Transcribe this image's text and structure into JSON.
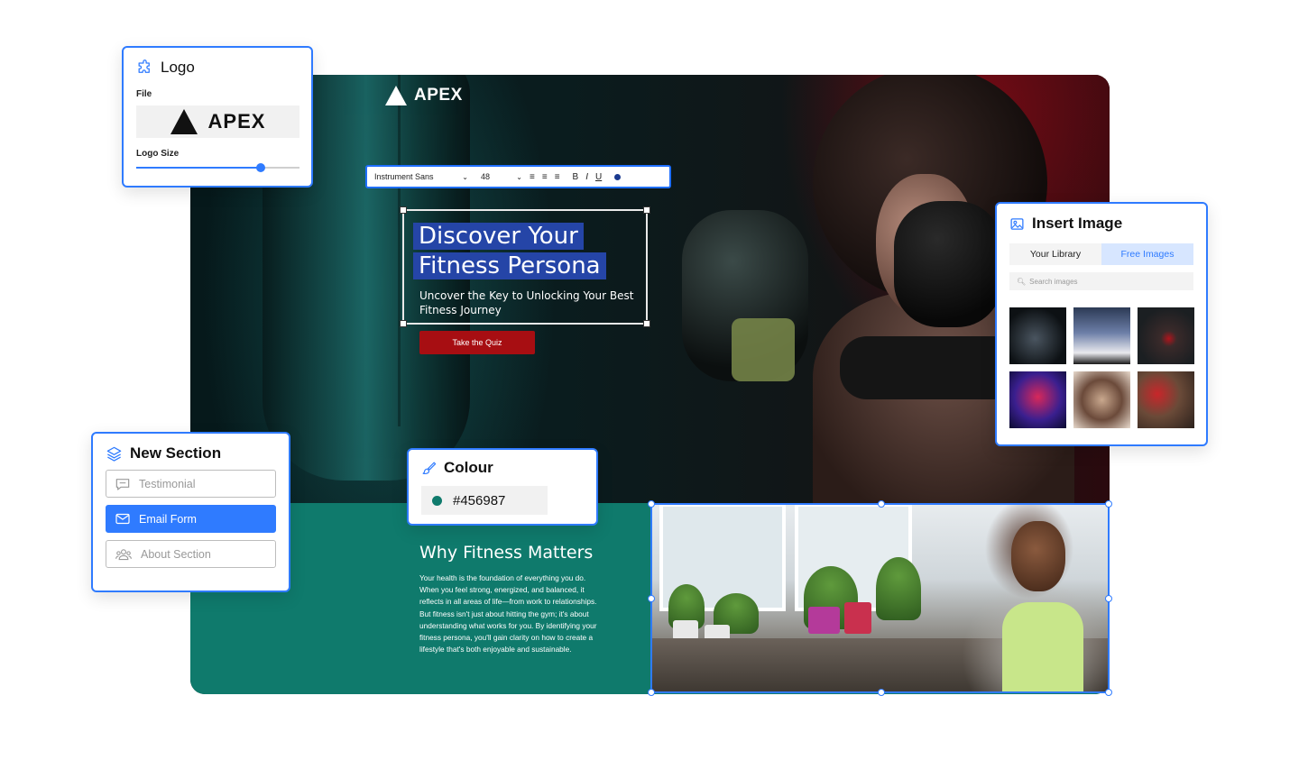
{
  "brand": {
    "name": "APEX"
  },
  "toolbar": {
    "font": "Instrument Sans",
    "size": "48",
    "align_left": "≡",
    "align_center": "≡",
    "align_right": "≡",
    "bold": "B",
    "italic": "I",
    "underline": "U"
  },
  "hero": {
    "title_line1": "Discover Your",
    "title_line2": "Fitness Persona",
    "subtitle": "Uncover the Key to Unlocking Your Best Fitness Journey",
    "cta": "Take the Quiz"
  },
  "why": {
    "title": "Why Fitness Matters",
    "body": "Your health is the foundation of everything you do. When you feel strong, energized, and balanced, it reflects in all areas of life—from work to relationships. But fitness isn't just about hitting the gym; it's about understanding what works for you. By identifying your fitness persona, you'll gain clarity on how to create a lifestyle that's both enjoyable and sustainable."
  },
  "logo_panel": {
    "title": "Logo",
    "file_label": "File",
    "preview_text": "APEX",
    "size_label": "Logo Size",
    "size_value": 0.76
  },
  "image_panel": {
    "title": "Insert Image",
    "tabs": [
      {
        "label": "Your Library",
        "active": false
      },
      {
        "label": "Free Images",
        "active": true
      }
    ],
    "search_placeholder": "Search images"
  },
  "section_panel": {
    "title": "New Section",
    "items": [
      {
        "label": "Testimonial",
        "icon": "chat-bubble-icon",
        "active": false
      },
      {
        "label": "Email Form",
        "icon": "envelope-icon",
        "active": true
      },
      {
        "label": "About Section",
        "icon": "people-icon",
        "active": false
      }
    ]
  },
  "colour_panel": {
    "title": "Colour",
    "hex": "#456987",
    "swatch_color": "#0f7a6c"
  },
  "colors": {
    "accent": "#2f7bff",
    "cta_red": "#a70e12",
    "teal_section": "#0f7a6c",
    "title_highlight": "#2545a7"
  }
}
